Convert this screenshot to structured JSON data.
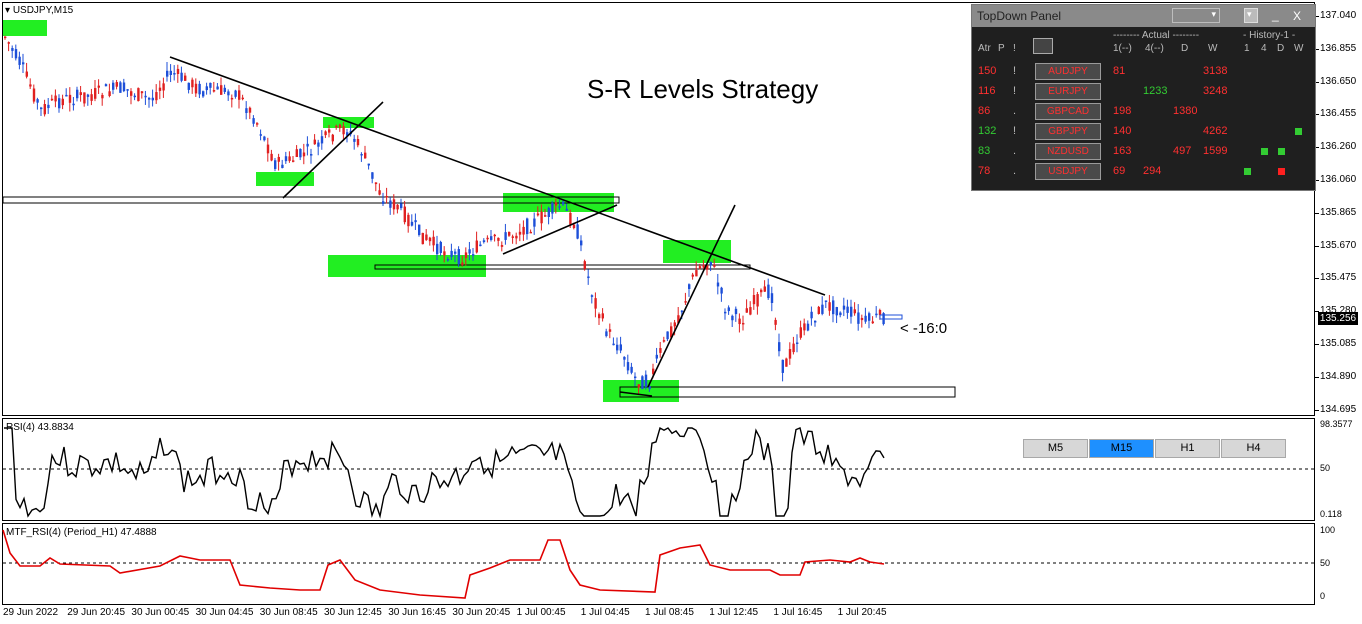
{
  "chart_header": "USDJPY,M15",
  "title_text": "S-R Levels Strategy",
  "countdown": "< -16:0",
  "current_price": "135.256",
  "price_ticks": [
    "137.040",
    "136.855",
    "136.650",
    "136.455",
    "136.260",
    "136.060",
    "135.865",
    "135.670",
    "135.475",
    "135.280",
    "135.085",
    "134.890",
    "134.695"
  ],
  "rsi": {
    "label": "RSI(4) 43.8834",
    "scale_top": "98.3577",
    "scale_mid": "50",
    "scale_bot": "0.118",
    "level": 50
  },
  "mtf_rsi": {
    "label": "MTF_RSI(4) (Period_H1) 47.4888",
    "scale_top": "100",
    "scale_mid": "50",
    "scale_bot": "0",
    "level": 50
  },
  "time_ticks": [
    "29 Jun 2022",
    "29 Jun 20:45",
    "30 Jun 00:45",
    "30 Jun 04:45",
    "30 Jun 08:45",
    "30 Jun 12:45",
    "30 Jun 16:45",
    "30 Jun 20:45",
    "1 Jul 00:45",
    "1 Jul 04:45",
    "1 Jul 08:45",
    "1 Jul 12:45",
    "1 Jul 16:45",
    "1 Jul 20:45"
  ],
  "timeframe_buttons": [
    {
      "label": "M5",
      "active": false
    },
    {
      "label": "M15",
      "active": true
    },
    {
      "label": "H1",
      "active": false
    },
    {
      "label": "H4",
      "active": false
    }
  ],
  "panel": {
    "title": "TopDown Panel",
    "minimize_glyph": "_",
    "close_glyph": "X",
    "actual_header": "-------- Actual --------",
    "history_header": "- History-1 -",
    "col_atr": "Atr",
    "col_p": "P",
    "col_bang": "!",
    "col_1": "1(--)",
    "col_4": "4(--)",
    "col_d": "D",
    "col_w": "W",
    "hist_cols": [
      "1",
      "4",
      "D",
      "W"
    ],
    "rows": [
      {
        "atr": "150",
        "flag": "!",
        "pair": "AUDJPY",
        "h1": "81",
        "h4": "",
        "d": "",
        "w": "3138",
        "h1c": "#ff3030",
        "h4c": "#ff3030",
        "dc": "#ff3030",
        "wc": "#ff3030",
        "atrc": "#ff3030",
        "hist": [
          "",
          "",
          "",
          ""
        ]
      },
      {
        "atr": "116",
        "flag": "!",
        "pair": "EURJPY",
        "h1": "",
        "h4": "1233",
        "d": "",
        "w": "3248",
        "h1c": "#ff3030",
        "h4c": "#33cc33",
        "dc": "#ff3030",
        "wc": "#ff3030",
        "atrc": "#ff3030",
        "hist": [
          "",
          "",
          "",
          ""
        ]
      },
      {
        "atr": "86",
        "flag": ".",
        "pair": "GBPCAD",
        "h1": "198",
        "h4": "",
        "d": "1380",
        "w": "",
        "h1c": "#ff3030",
        "h4c": "#ff3030",
        "dc": "#ff3030",
        "wc": "#ff3030",
        "atrc": "#ff3030",
        "hist": [
          "",
          "",
          "",
          ""
        ]
      },
      {
        "atr": "132",
        "flag": "!",
        "pair": "GBPJPY",
        "h1": "140",
        "h4": "",
        "d": "",
        "w": "4262",
        "h1c": "#ff3030",
        "h4c": "#ff3030",
        "dc": "#ff3030",
        "wc": "#ff3030",
        "atrc": "#33cc33",
        "hist": [
          "",
          "",
          "",
          "green"
        ]
      },
      {
        "atr": "83",
        "flag": ".",
        "pair": "NZDUSD",
        "h1": "163",
        "h4": "",
        "d": "497",
        "w": "1599",
        "h1c": "#ff3030",
        "h4c": "#ff3030",
        "dc": "#ff3030",
        "wc": "#ff3030",
        "atrc": "#33cc33",
        "hist": [
          "",
          "green",
          "green",
          ""
        ]
      },
      {
        "atr": "78",
        "flag": ".",
        "pair": "USDJPY",
        "h1": "69",
        "h4": "294",
        "d": "",
        "w": "",
        "h1c": "#ff3030",
        "h4c": "#ff3030",
        "dc": "#ff3030",
        "wc": "#ff3030",
        "atrc": "#ff3030",
        "hist": [
          "green",
          "",
          "red",
          ""
        ]
      }
    ]
  },
  "colors": {
    "bull": "#1d4fd8",
    "bear": "#e02020",
    "zone": "#22ee22",
    "rsi_line": "#000000",
    "mtf_line": "#e00000"
  }
}
